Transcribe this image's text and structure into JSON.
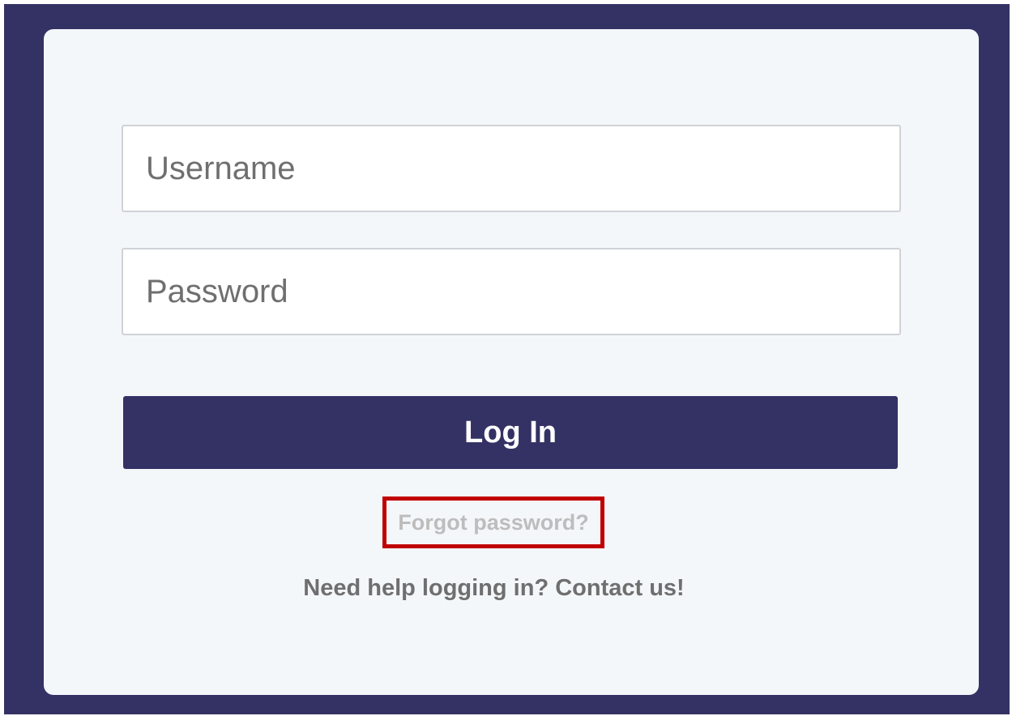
{
  "login_form": {
    "username_placeholder": "Username",
    "username_value": "",
    "password_placeholder": "Password",
    "password_value": "",
    "login_label": "Log In",
    "forgot_password_label": "Forgot password?",
    "help_label": "Need help logging in? Contact us!"
  },
  "colors": {
    "frame_background": "#343264",
    "card_background": "#f4f7fa",
    "button_background": "#343264",
    "highlight_border": "#c00000",
    "forgot_link_text": "#bdbdbd",
    "help_text": "#6f6f6f"
  }
}
